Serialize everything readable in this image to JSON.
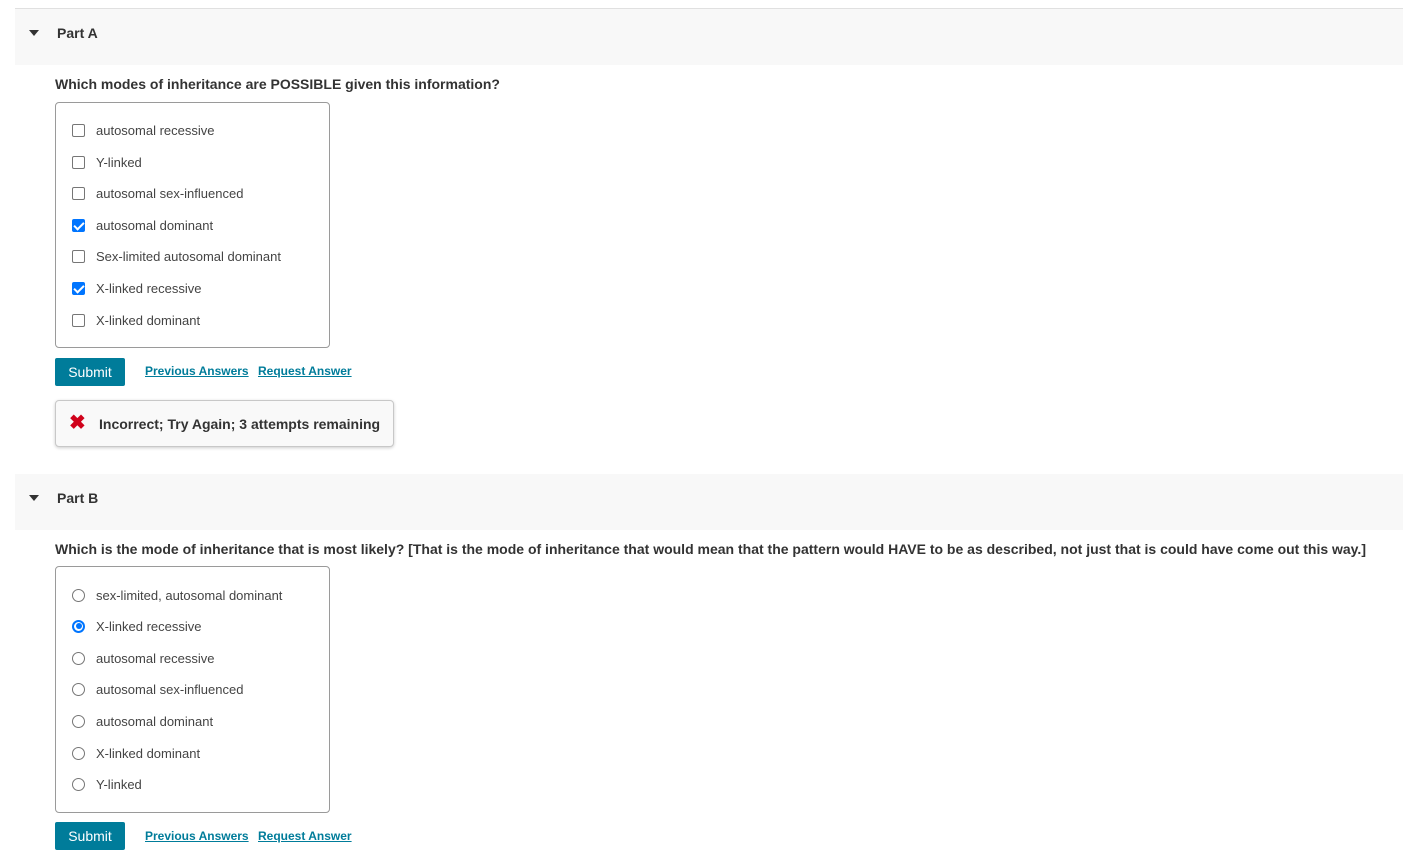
{
  "partA": {
    "title": "Part A",
    "question": "Which modes of inheritance are POSSIBLE given this information?",
    "options": [
      {
        "label": "autosomal recessive",
        "checked": false
      },
      {
        "label": "Y-linked",
        "checked": false
      },
      {
        "label": "autosomal sex-influenced",
        "checked": false
      },
      {
        "label": "autosomal dominant",
        "checked": true
      },
      {
        "label": "Sex-limited autosomal dominant",
        "checked": false
      },
      {
        "label": "X-linked recessive",
        "checked": true
      },
      {
        "label": "X-linked dominant",
        "checked": false
      }
    ],
    "submit_label": "Submit",
    "previous_answers_label": "Previous Answers",
    "request_answer_label": "Request Answer",
    "feedback": "Incorrect; Try Again; 3 attempts remaining",
    "feedback_icon": "x-mark-icon",
    "feedback_color": "#d0021b"
  },
  "partB": {
    "title": "Part B",
    "question": "Which is the mode of inheritance that is most likely? [That is the mode of inheritance that would mean that the pattern would HAVE to be as described, not just that is could have come out this way.]",
    "options": [
      {
        "label": "sex-limited, autosomal dominant",
        "checked": false
      },
      {
        "label": "X-linked recessive",
        "checked": true
      },
      {
        "label": "autosomal recessive",
        "checked": false
      },
      {
        "label": "autosomal sex-influenced",
        "checked": false
      },
      {
        "label": "autosomal dominant",
        "checked": false
      },
      {
        "label": "X-linked dominant",
        "checked": false
      },
      {
        "label": "Y-linked",
        "checked": false
      }
    ],
    "submit_label": "Submit",
    "previous_answers_label": "Previous Answers",
    "request_answer_label": "Request Answer"
  },
  "colors": {
    "accent": "#007c9a",
    "checked": "#0075ff"
  }
}
